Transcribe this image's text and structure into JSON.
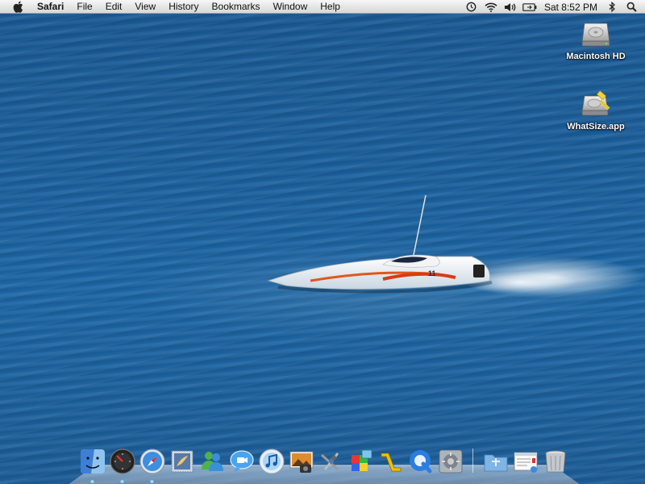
{
  "menubar": {
    "apple_icon": "apple-icon",
    "app_name": "Safari",
    "menus": [
      "File",
      "Edit",
      "View",
      "History",
      "Bookmarks",
      "Window",
      "Help"
    ],
    "status_icons": [
      "time-machine-icon",
      "wifi-icon",
      "volume-icon",
      "battery-icon"
    ],
    "clock": "Sat 8:52 PM",
    "extra_icons": [
      "bluetooth-icon",
      "spotlight-search-icon"
    ]
  },
  "desktop": {
    "icons": [
      {
        "label": "Macintosh HD",
        "icon": "hard-drive-icon"
      },
      {
        "label": "WhatSize.app",
        "icon": "whatsize-app-icon"
      }
    ]
  },
  "dock": {
    "apps": [
      {
        "icon": "finder-icon",
        "running": true
      },
      {
        "icon": "dashboard-icon",
        "running": true
      },
      {
        "icon": "safari-icon",
        "running": true
      },
      {
        "icon": "mail-icon",
        "running": false
      },
      {
        "icon": "messenger-icon",
        "running": false
      },
      {
        "icon": "ichat-icon",
        "running": false
      },
      {
        "icon": "itunes-icon",
        "running": false
      },
      {
        "icon": "iphoto-icon",
        "running": false
      },
      {
        "icon": "xcode-icon",
        "running": false
      },
      {
        "icon": "office-remote-desktop-icon",
        "running": false
      },
      {
        "icon": "office-icon",
        "running": false
      },
      {
        "icon": "quicktime-icon",
        "running": false
      },
      {
        "icon": "system-preferences-icon",
        "running": false
      }
    ],
    "stacks": [
      {
        "icon": "applications-folder-icon"
      },
      {
        "icon": "downloads-stack-icon"
      },
      {
        "icon": "trash-icon"
      }
    ]
  },
  "colors": {
    "wallpaper": "#1b5f9c",
    "menubar": "#e6e6e6"
  }
}
